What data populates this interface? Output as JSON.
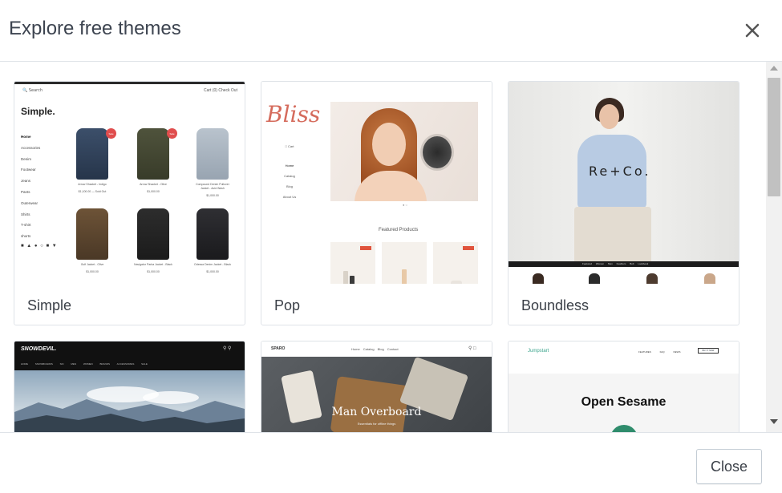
{
  "header": {
    "title": "Explore free themes",
    "close_icon": "close-icon"
  },
  "themes": [
    {
      "name": "Simple",
      "preview": {
        "search": "Search",
        "cart": "Cart (0)   Check Out",
        "brand": "Simple.",
        "nav": [
          "Home",
          "Accessories",
          "Denim",
          "Footwear",
          "Jeans",
          "Pants",
          "Outerwear",
          "Shirts",
          "T-shirt",
          "shorts"
        ],
        "products": [
          {
            "caption": "Arrow Shacket - Indigo",
            "price": "$1,100.00 — Sold Out",
            "sale": "Sale"
          },
          {
            "caption": "Arrow Shacket - Olive",
            "price": "$1,000.00",
            "sale": "Sale"
          },
          {
            "caption": "Compound Denim Pullover Jacket - Acid Wash",
            "price": "$1,000.00",
            "sale": ""
          },
          {
            "caption": "Gulf Jacket - Olive",
            "price": "$1,000.00",
            "sale": ""
          },
          {
            "caption": "Navigator Parka Jacket - Black",
            "price": "$1,000.00",
            "sale": ""
          },
          {
            "caption": "Odessa Denim Jacket - Black",
            "price": "$1,000.00",
            "sale": ""
          }
        ]
      }
    },
    {
      "name": "Pop",
      "preview": {
        "logo": "Bliss",
        "cart": "Cart",
        "nav": [
          "Home",
          "Catalog",
          "Blog",
          "About Us"
        ],
        "featured": "Featured Products"
      }
    },
    {
      "name": "Boundless",
      "preview": {
        "brand": "Re+Co.",
        "nav": "Featured Women Men Feathers Bolt Lookbook"
      }
    },
    {
      "name": "",
      "preview": {
        "brand": "SNOWDEVIL.",
        "nav": "HOME SNOWBOARDS SKI MEN WOMEN BRANDS ACCESSORIES SALE"
      }
    },
    {
      "name": "",
      "preview": {
        "brand": "SPARO",
        "nav": "Home Catalog Blog Contact",
        "hero_title": "Man Overboard",
        "hero_sub": "Essentials for offline things"
      }
    },
    {
      "name": "",
      "preview": {
        "brand": "Jumpstart",
        "nav": "FEATURES FAQ NEWS",
        "button": "BUY IT NOW",
        "hero_title": "Open Sesame"
      }
    }
  ],
  "footer": {
    "close_label": "Close"
  },
  "colors": {
    "border": "#dfe3e8",
    "text": "#3a3f47",
    "accent_pop": "#d56b5c",
    "jumpstart_green": "#3aa38b"
  }
}
